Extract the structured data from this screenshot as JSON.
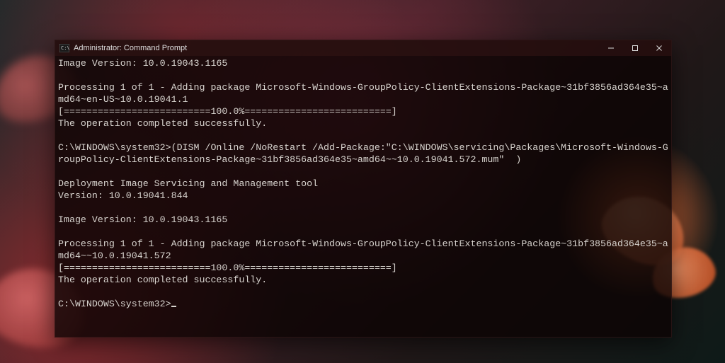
{
  "window": {
    "title": "Administrator: Command Prompt"
  },
  "terminal": {
    "lines": [
      "Image Version: 10.0.19043.1165",
      "",
      "Processing 1 of 1 - Adding package Microsoft-Windows-GroupPolicy-ClientExtensions-Package~31bf3856ad364e35~amd64~en-US~10.0.19041.1",
      "[==========================100.0%==========================]",
      "The operation completed successfully.",
      "",
      "C:\\WINDOWS\\system32>(DISM /Online /NoRestart /Add-Package:\"C:\\WINDOWS\\servicing\\Packages\\Microsoft-Windows-GroupPolicy-ClientExtensions-Package~31bf3856ad364e35~amd64~~10.0.19041.572.mum\"  )",
      "",
      "Deployment Image Servicing and Management tool",
      "Version: 10.0.19041.844",
      "",
      "Image Version: 10.0.19043.1165",
      "",
      "Processing 1 of 1 - Adding package Microsoft-Windows-GroupPolicy-ClientExtensions-Package~31bf3856ad364e35~amd64~~10.0.19041.572",
      "[==========================100.0%==========================]",
      "The operation completed successfully.",
      ""
    ],
    "prompt": "C:\\WINDOWS\\system32>"
  }
}
